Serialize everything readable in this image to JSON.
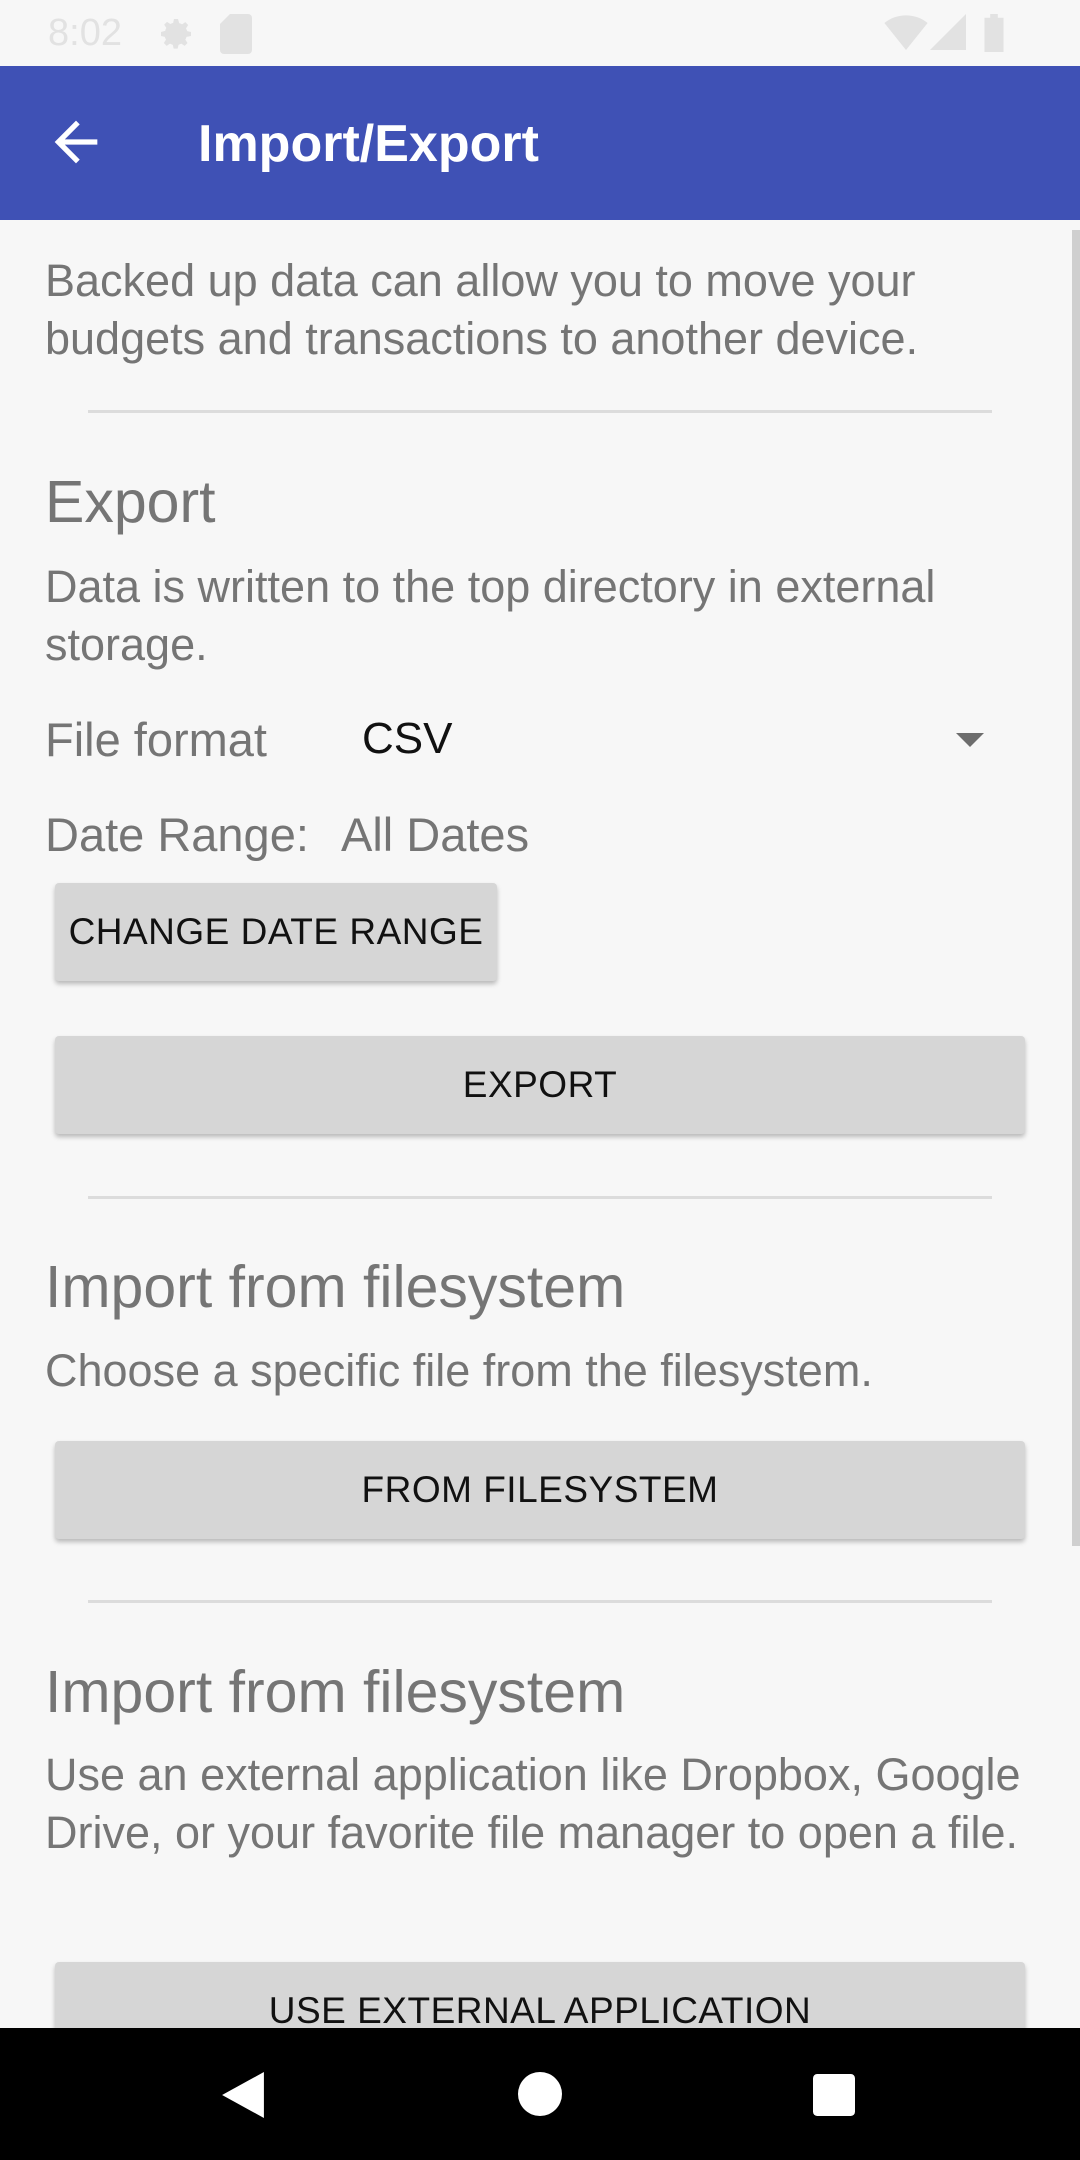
{
  "status_bar": {
    "time": "8:02"
  },
  "app_bar": {
    "title": "Import/Export"
  },
  "intro": {
    "text": "Backed up data can allow you to move your budgets and transactions to another device."
  },
  "export": {
    "heading": "Export",
    "description": "Data is written to the top directory in external storage.",
    "file_format_label": "File format",
    "file_format_value": "CSV",
    "date_range_label": "Date Range:",
    "date_range_value": "All Dates",
    "change_date_range_button": "CHANGE DATE RANGE",
    "export_button": "EXPORT"
  },
  "import_filesystem": {
    "heading": "Import from filesystem",
    "description": "Choose a specific file from the filesystem.",
    "button": "FROM FILESYSTEM"
  },
  "import_external": {
    "heading": "Import from filesystem",
    "description": "Use an external application like Dropbox, Google Drive, or your favorite file manager to open a file.",
    "button": "USE EXTERNAL APPLICATION"
  },
  "colors": {
    "app_bar": "#3f51b5",
    "background": "#f7f7f7",
    "button": "#d6d6d6"
  }
}
